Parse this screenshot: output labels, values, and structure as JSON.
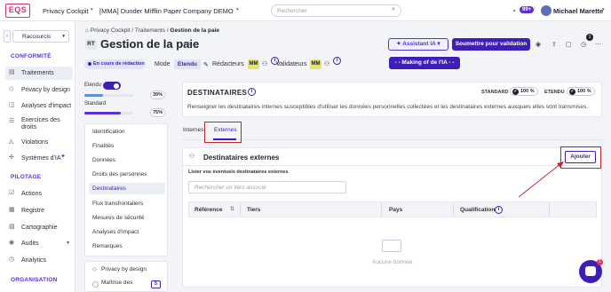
{
  "topbar": {
    "logo": "EQS",
    "app_name": "Privacy Cockpit",
    "company": "[MMA] Dunder Mifflin Paper Company DEMO",
    "search_placeholder": "Rechercher",
    "notifications_count": "99+",
    "user_name": "Michael Marette"
  },
  "sidebar": {
    "shortcuts_label": "Raccourcis",
    "section_conformite": "CONFORMITÉ",
    "items_conformite": [
      "Traitements",
      "Privacy by design",
      "Analyses d'impact",
      "Exercices des",
      "droits",
      "Violations",
      "Systèmes d'IA"
    ],
    "section_pilotage": "PILOTAGE",
    "items_pilotage": [
      "Actions",
      "Registre",
      "Cartographie",
      "Audits",
      "Analytics"
    ],
    "section_organisation": "ORGANISATION"
  },
  "breadcrumb": {
    "items": [
      "Privacy Cockpit",
      "Traitements",
      "Gestion de la paie"
    ],
    "separator": "/"
  },
  "header": {
    "badge": "RT",
    "title": "Gestion de la paie",
    "ia_assistant_label": "Assistant IA",
    "submit_label": "Soumettre pour validation",
    "notification_count": "1"
  },
  "meta": {
    "status": "En cours de rédaction",
    "mode_label": "Mode",
    "mode_value": "Etendu",
    "redacteurs_label": "Rédacteurs",
    "redacteurs_initials": "MM",
    "validateurs_label": "Validateurs",
    "validateurs_initials": "MM",
    "making_of_label": "- - Making of de l'IA - -"
  },
  "progress": {
    "etendu_label": "Etendu",
    "etendu_pct": "39%",
    "etendu_value": 0.39,
    "standard_label": "Standard",
    "standard_pct": "75%",
    "standard_value": 0.75
  },
  "steps": [
    "Identification",
    "Finalités",
    "Données",
    "Droits des personnes",
    "Destinataires",
    "Flux transfrontaliers",
    "Mesures de sécurité",
    "Analyses d'impact",
    "Remarques"
  ],
  "sub_steps": [
    "Privacy by design",
    "Maîtrise des"
  ],
  "sub_step_count": "5",
  "destinataires": {
    "title": "DESTINATAIRES",
    "description": "Renseigner les destinataires internes susceptibles d'utiliser les données personnelles collectées et les destinataires externes auxquels elles sont transmises.",
    "standard_label": "STANDARD",
    "standard_pct": "100 %",
    "etendu_label": "ETENDU",
    "etendu_pct": "100 %"
  },
  "tabs": [
    "Internes",
    "Externes"
  ],
  "externes": {
    "title": "Destinataires externes",
    "add_label": "Ajouter",
    "list_label": "Lister vos éventuels destinataires externes",
    "search_placeholder": "Rechercher un tiers associé",
    "columns": [
      "Référence",
      "Tiers",
      "Pays",
      "Qualification"
    ],
    "empty_text": "Aucune donnée"
  },
  "chat_badge": "1"
}
